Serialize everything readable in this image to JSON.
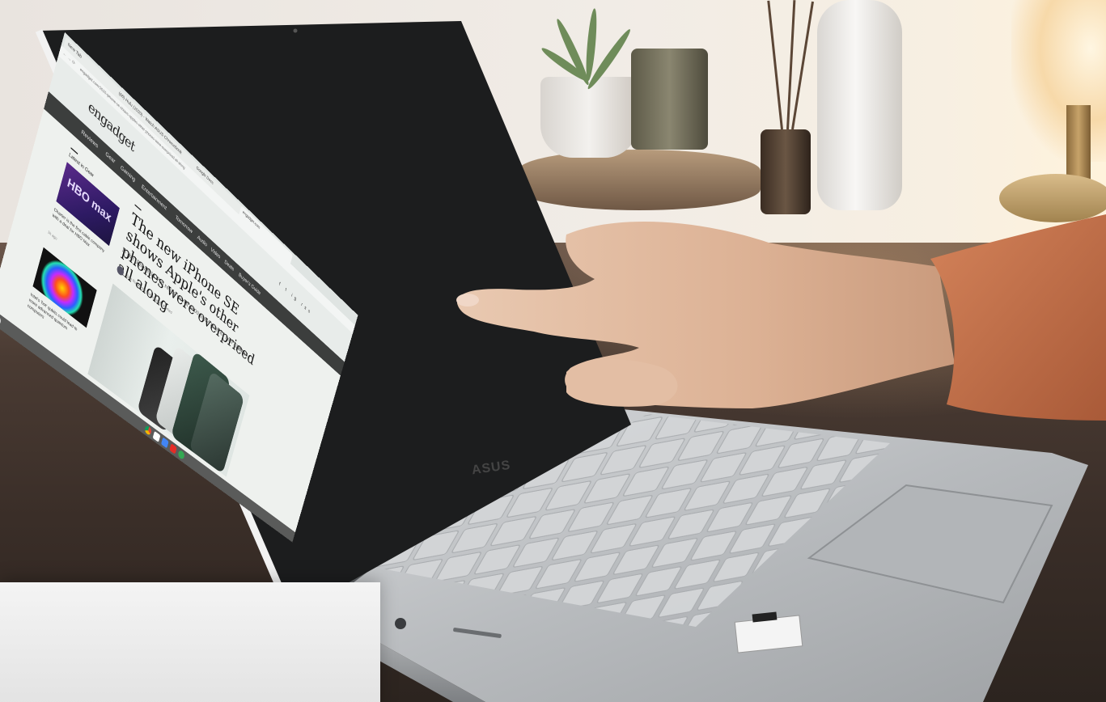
{
  "browser": {
    "tabs": [
      {
        "label": "New Tab"
      },
      {
        "label": "(66) Hulu (2020) - Watch ASUS Chromebook"
      },
      {
        "label": "Google Docs"
      },
      {
        "label": "engadget.com"
      }
    ],
    "url": "engadget.com/2020-iphone-se-shows-apples-other-phones-were-overpriced-all-along"
  },
  "site": {
    "logo": "engadget",
    "social": "f  t  ig  rss",
    "menu": [
      "Reviews",
      "Gear",
      "Gaming",
      "Entertainment",
      "Tomorrow",
      "Audio",
      "Video",
      "Deals",
      "Buyer's Guide"
    ],
    "latest_label": "Latest in Gear",
    "cards": [
      {
        "image_text": "HBO max",
        "caption": "Charter is the first cable company with a deal for HBO Max",
        "time": "1h ago"
      },
      {
        "image_text": "",
        "caption": "Intel's 'hot' qubits could lead to more advanced quantum computers"
      }
    ],
    "headline": "The new iPhone SE shows Apple's other phones were overpriced all along",
    "dek": "Is the iPhone 11 Pro really worth $600 more than its new sibling?",
    "comments_label": "2676",
    "byline": "Sam Rutherford, @AlsoSamRutherford"
  },
  "laptop": {
    "brand": "ASUS"
  },
  "colors": {
    "menu_bar": "#3c3e3d",
    "page_bg": "#eef1ee",
    "laptop_silver": "#b9bcbf",
    "desk": "#3b302a"
  },
  "icons": [
    "chrome-icon",
    "gmail-icon",
    "docs-icon",
    "youtube-icon",
    "play-store-icon",
    "launcher-icon"
  ]
}
